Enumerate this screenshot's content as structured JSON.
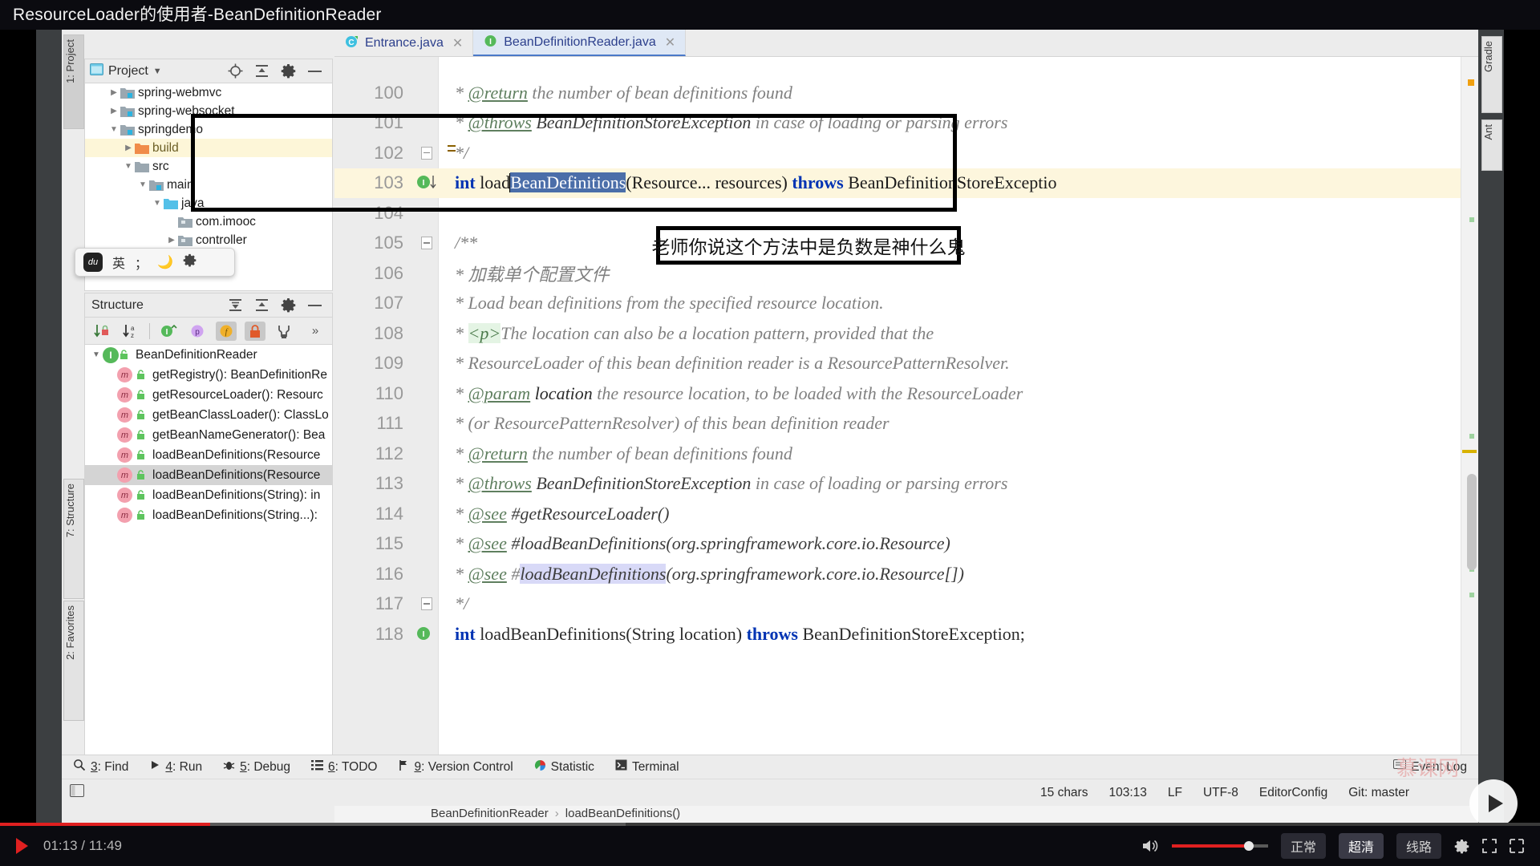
{
  "video": {
    "title": "ResourceLoader的使用者-BeanDefinitionReader",
    "time_current": "01:13",
    "time_total": "11:49",
    "time_display": "01:13 / 11:49",
    "quality_options": [
      "正常",
      "超清",
      "线路"
    ],
    "watermark": "慕课网",
    "play_icon": "play-icon",
    "volume_icon": "volume-icon",
    "settings_icon": "gear-icon",
    "fullscreen_icon": "fullscreen-icon",
    "expand_icon": "expand-icon"
  },
  "annotation": {
    "note_text": "老师你说这个方法中是负数是神什么鬼"
  },
  "ide": {
    "left_rail": [
      {
        "label": "1: Project",
        "name": "rail-project"
      },
      {
        "label": "7: Structure",
        "name": "rail-structure"
      },
      {
        "label": "2: Favorites",
        "name": "rail-favorites"
      }
    ],
    "right_rail": [
      {
        "label": "Gradle",
        "name": "rail-gradle"
      },
      {
        "label": "Ant",
        "name": "rail-ant"
      }
    ],
    "project_panel": {
      "title": "Project",
      "dropdown_icon": "chevron-down-icon",
      "locate_icon": "locate-icon",
      "collapse_icon": "collapse-all-icon",
      "settings_icon": "gear-icon",
      "hide_icon": "minimize-icon",
      "items": [
        {
          "label": "spring-webmvc",
          "indent": 1,
          "arrow": "collapsed",
          "icon": "module-folder-icon",
          "highlight": false
        },
        {
          "label": "spring-websocket",
          "indent": 1,
          "arrow": "collapsed",
          "icon": "module-folder-icon",
          "highlight": false
        },
        {
          "label": "springdemo",
          "indent": 1,
          "arrow": "expanded",
          "icon": "module-folder-icon",
          "highlight": false
        },
        {
          "label": "build",
          "indent": 2,
          "arrow": "collapsed",
          "icon": "excluded-folder-icon",
          "highlight": true
        },
        {
          "label": "src",
          "indent": 2,
          "arrow": "expanded",
          "icon": "folder-icon",
          "highlight": false
        },
        {
          "label": "main",
          "indent": 3,
          "arrow": "expanded",
          "icon": "module-folder-icon",
          "highlight": false
        },
        {
          "label": "java",
          "indent": 4,
          "arrow": "expanded",
          "icon": "source-folder-icon",
          "highlight": false
        },
        {
          "label": "com.imooc",
          "indent": 5,
          "arrow": "none",
          "icon": "package-icon",
          "highlight": false
        },
        {
          "label": "controller",
          "indent": 6,
          "arrow": "collapsed",
          "icon": "package-icon",
          "highlight": false
        }
      ]
    },
    "structure_panel": {
      "title": "Structure",
      "expand_icon": "expand-all-icon",
      "collapse_icon": "collapse-all-icon",
      "settings_icon": "gear-icon",
      "hide_icon": "minimize-icon",
      "toolbar_buttons": [
        {
          "name": "sort-by-visibility-button",
          "glyph": "↓",
          "active": false
        },
        {
          "name": "sort-alphabetically-button",
          "glyph": "↓",
          "active": false
        },
        {
          "name": "show-inherited-button",
          "glyph": "I",
          "active": false
        },
        {
          "name": "show-properties-button",
          "glyph": "p",
          "active": false
        },
        {
          "name": "show-fields-button",
          "glyph": "f",
          "active": true
        },
        {
          "name": "show-non-public-button",
          "glyph": "lock",
          "active": true
        },
        {
          "name": "show-hierarchy-button",
          "glyph": "Y",
          "active": false
        },
        {
          "name": "more-button",
          "glyph": "»",
          "active": false
        }
      ],
      "items": [
        {
          "label": "BeanDefinitionReader",
          "kind": "interface",
          "indent": 0,
          "arrow": "expanded",
          "selected": false
        },
        {
          "label": "getRegistry(): BeanDefinitionRe",
          "kind": "method",
          "indent": 1,
          "arrow": "none",
          "selected": false
        },
        {
          "label": "getResourceLoader(): Resourc",
          "kind": "method",
          "indent": 1,
          "arrow": "none",
          "selected": false
        },
        {
          "label": "getBeanClassLoader(): ClassLo",
          "kind": "method",
          "indent": 1,
          "arrow": "none",
          "selected": false
        },
        {
          "label": "getBeanNameGenerator(): Bea",
          "kind": "method",
          "indent": 1,
          "arrow": "none",
          "selected": false
        },
        {
          "label": "loadBeanDefinitions(Resource",
          "kind": "method",
          "indent": 1,
          "arrow": "none",
          "selected": false
        },
        {
          "label": "loadBeanDefinitions(Resource",
          "kind": "method",
          "indent": 1,
          "arrow": "none",
          "selected": true
        },
        {
          "label": "loadBeanDefinitions(String): in",
          "kind": "method",
          "indent": 1,
          "arrow": "none",
          "selected": false
        },
        {
          "label": "loadBeanDefinitions(String...):",
          "kind": "method",
          "indent": 1,
          "arrow": "none",
          "selected": false
        }
      ]
    },
    "tabs": [
      {
        "label": "Entrance.java",
        "icon": "class-icon",
        "active": false,
        "close_icon": "close-icon"
      },
      {
        "label": "BeanDefinitionReader.java",
        "icon": "interface-icon",
        "active": true,
        "close_icon": "close-icon"
      }
    ],
    "breadcrumb": {
      "parts": [
        "BeanDefinitionReader",
        "loadBeanDefinitions()"
      ],
      "separator": "›"
    },
    "code": {
      "lines": [
        {
          "num": "100",
          "text": "* @return the number of bean definitions found",
          "type": "javadoc",
          "gutter": "",
          "highlight": false
        },
        {
          "num": "101",
          "text": "* @throws BeanDefinitionStoreException in case of loading or parsing errors",
          "type": "javadoc",
          "gutter": "",
          "highlight": false
        },
        {
          "num": "102",
          "text": "*/",
          "type": "javadoc",
          "gutter": "fold-bulb",
          "highlight": false
        },
        {
          "num": "103",
          "text": "int loadBeanDefinitions(Resource... resources) throws BeanDefinitionStoreExceptio",
          "type": "java",
          "gutter": "impl",
          "highlight": true
        },
        {
          "num": "104",
          "text": "",
          "type": "java",
          "gutter": "",
          "highlight": false
        },
        {
          "num": "105",
          "text": "/**",
          "type": "javadoc",
          "gutter": "fold",
          "highlight": false
        },
        {
          "num": "106",
          "text": "* 加载单个配置文件",
          "type": "javadoc",
          "gutter": "",
          "highlight": false
        },
        {
          "num": "107",
          "text": "* Load bean definitions from the specified resource location.",
          "type": "javadoc",
          "gutter": "",
          "highlight": false
        },
        {
          "num": "108",
          "text": "* <p>The location can also be a location pattern, provided that the",
          "type": "javadoc",
          "gutter": "",
          "highlight": false
        },
        {
          "num": "109",
          "text": "* ResourceLoader of this bean definition reader is a ResourcePatternResolver.",
          "type": "javadoc",
          "gutter": "",
          "highlight": false
        },
        {
          "num": "110",
          "text": "* @param location the resource location, to be loaded with the ResourceLoader",
          "type": "javadoc",
          "gutter": "",
          "highlight": false
        },
        {
          "num": "111",
          "text": "* (or ResourcePatternResolver) of this bean definition reader",
          "type": "javadoc",
          "gutter": "",
          "highlight": false
        },
        {
          "num": "112",
          "text": "* @return the number of bean definitions found",
          "type": "javadoc",
          "gutter": "",
          "highlight": false
        },
        {
          "num": "113",
          "text": "* @throws BeanDefinitionStoreException in case of loading or parsing errors",
          "type": "javadoc",
          "gutter": "",
          "highlight": false
        },
        {
          "num": "114",
          "text": "* @see #getResourceLoader()",
          "type": "javadoc",
          "gutter": "",
          "highlight": false
        },
        {
          "num": "115",
          "text": "* @see #loadBeanDefinitions(org.springframework.core.io.Resource)",
          "type": "javadoc",
          "gutter": "",
          "highlight": false
        },
        {
          "num": "116",
          "text": "* @see #loadBeanDefinitions(org.springframework.core.io.Resource[])",
          "type": "javadoc",
          "gutter": "",
          "highlight": false
        },
        {
          "num": "117",
          "text": "*/",
          "type": "javadoc",
          "gutter": "fold",
          "highlight": false
        },
        {
          "num": "118",
          "text": "int loadBeanDefinitions(String location) throws BeanDefinitionStoreException;",
          "type": "java",
          "gutter": "impl",
          "highlight": false
        }
      ],
      "line103": {
        "keyword": "int",
        "before_selection": " load",
        "selection": "BeanDefinitions",
        "after_selection": "(Resource... resources) ",
        "throws_keyword": "throws",
        "tail": " BeanDefinitionStoreExceptio"
      }
    },
    "tool_window_bar": [
      {
        "num": "3",
        "label": ": Find",
        "icon": "search-icon"
      },
      {
        "num": "4",
        "label": ": Run",
        "icon": "run-icon"
      },
      {
        "num": "5",
        "label": ": Debug",
        "icon": "debug-icon"
      },
      {
        "num": "6",
        "label": ": TODO",
        "icon": "todo-icon"
      },
      {
        "num": "9",
        "label": ": Version Control",
        "icon": "vcs-icon"
      },
      {
        "num": "",
        "label": "Statistic",
        "icon": "statistic-icon"
      },
      {
        "num": "",
        "label": "Terminal",
        "icon": "terminal-icon"
      }
    ],
    "event_log": {
      "label": "Event Log",
      "icon": "event-log-icon"
    },
    "status_bar": {
      "chars": "15 chars",
      "caret": "103:13",
      "line_separator": "LF",
      "encoding": "UTF-8",
      "editor_config": "EditorConfig",
      "git_branch": "Git: master"
    }
  },
  "ime": {
    "logo": "du",
    "mode": "英",
    "punct": "；",
    "moon_icon": "moon-icon",
    "gear_icon": "gear-icon"
  },
  "colors": {
    "accent_blue": "#4b6ea9",
    "selection_soft": "#d8d9f7",
    "line_highlight": "#fdf6dd",
    "keyword": "#0033b3",
    "progress_red": "#e02020",
    "ide_bg": "#ececec"
  }
}
